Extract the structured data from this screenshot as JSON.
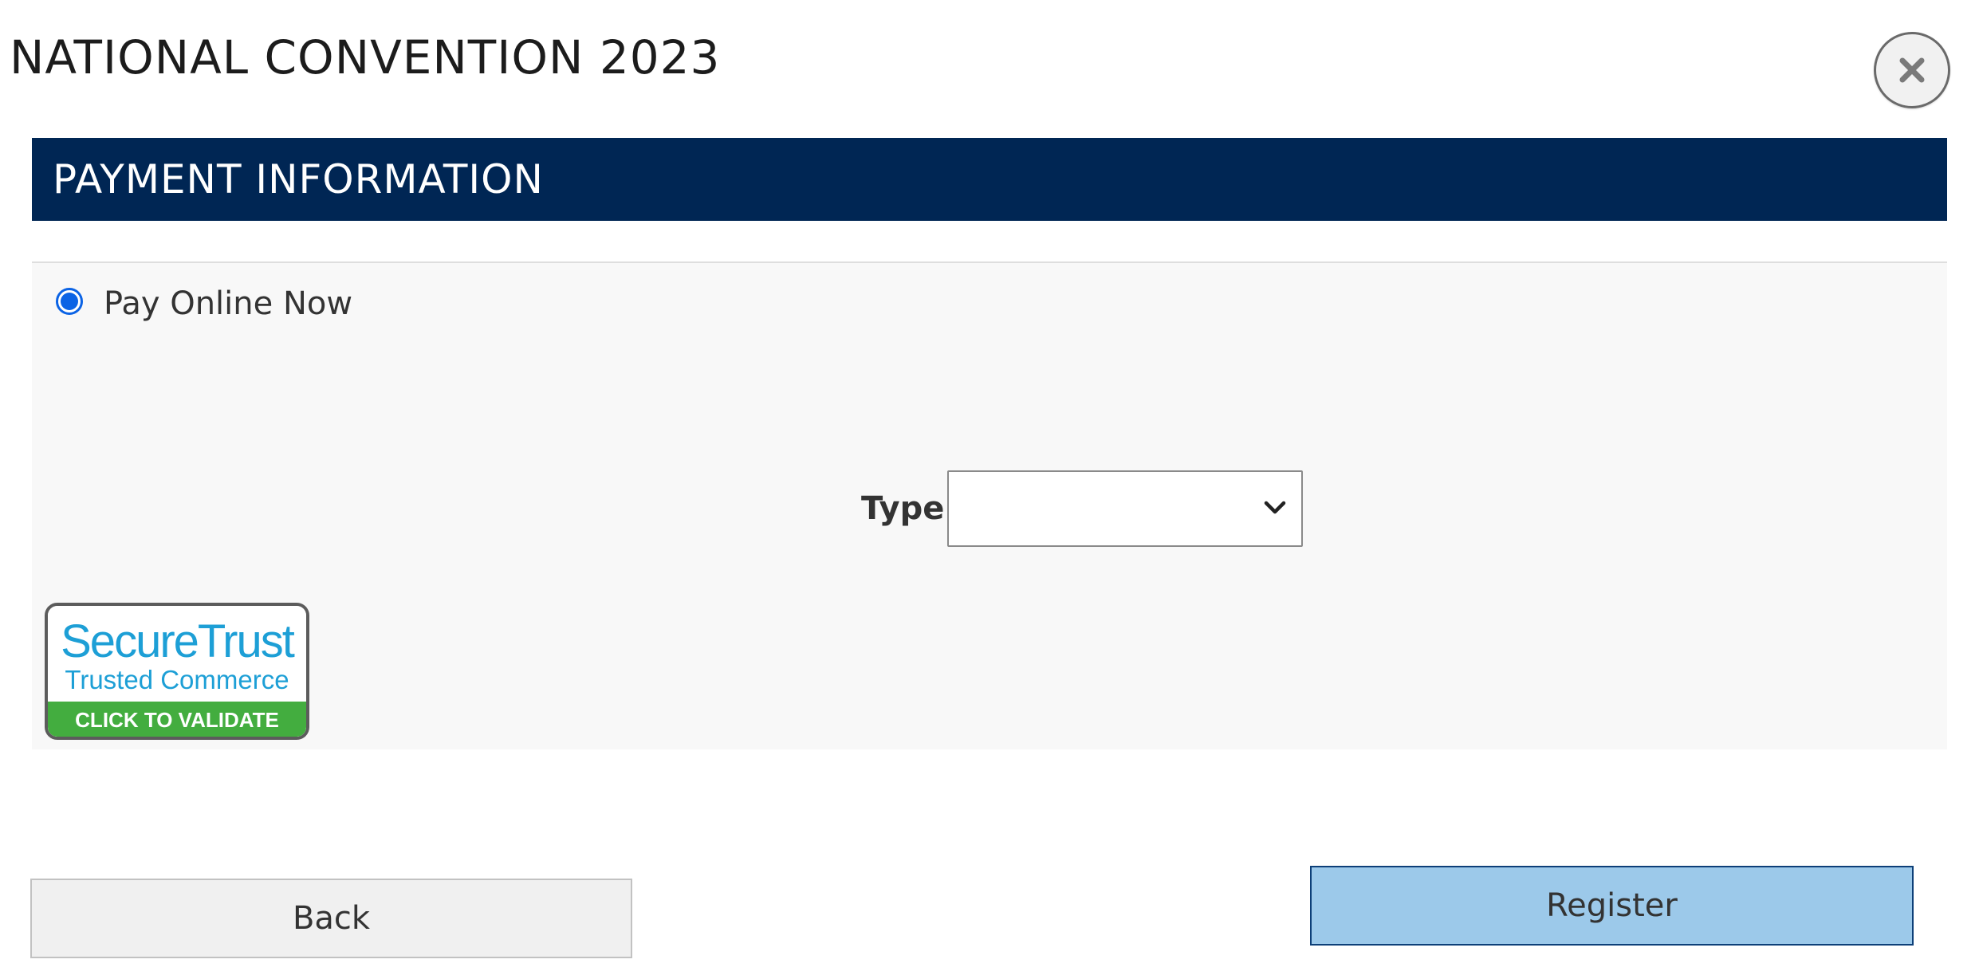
{
  "header": {
    "title": "NATIONAL CONVENTION 2023",
    "close_icon": "close-icon"
  },
  "payment_section": {
    "title": "PAYMENT INFORMATION",
    "option": {
      "label": "Pay Online Now",
      "selected": true
    },
    "type_field": {
      "label": "Type",
      "value": ""
    },
    "seal": {
      "line1": "SecureTrust",
      "line2": "Trusted Commerce",
      "line3": "CLICK TO VALIDATE"
    }
  },
  "actions": {
    "back_label": "Back",
    "register_label": "Register"
  },
  "colors": {
    "header_bg": "#002654",
    "register_bg": "#9cc9ea",
    "radio_accent": "#0b63e5",
    "seal_green": "#43ad3f",
    "seal_blue": "#1d9fd6"
  }
}
